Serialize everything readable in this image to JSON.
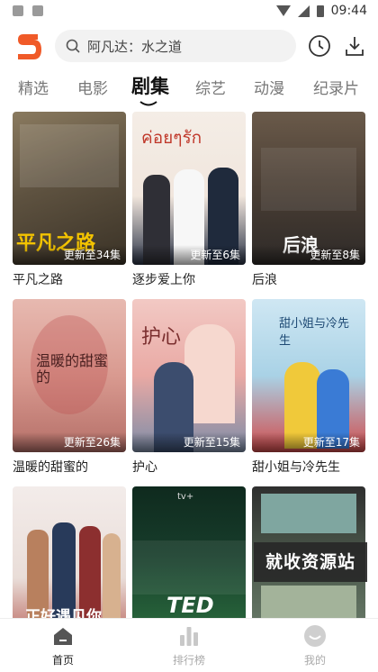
{
  "status_bar": {
    "time": "09:44"
  },
  "header": {
    "search_placeholder": "阿凡达：水之道"
  },
  "tabs": [
    {
      "label": "精选"
    },
    {
      "label": "电影"
    },
    {
      "label": "剧集",
      "active": true
    },
    {
      "label": "综艺"
    },
    {
      "label": "动漫"
    },
    {
      "label": "纪录片"
    }
  ],
  "cards": [
    {
      "title": "平凡之路",
      "update": "更新至34集",
      "poster_text": "平凡之路"
    },
    {
      "title": "逐步爱上你",
      "update": "更新至6集",
      "poster_text": "ค่อยๆรัก"
    },
    {
      "title": "后浪",
      "update": "更新至8集",
      "poster_text": "后浪"
    },
    {
      "title": "温暖的甜蜜的",
      "update": "更新至26集",
      "poster_text": "温暖的甜蜜的"
    },
    {
      "title": "护心",
      "update": "更新至15集",
      "poster_text": "护心"
    },
    {
      "title": "甜小姐与冷先生",
      "update": "更新至17集",
      "poster_text": "甜小姐与冷先生"
    },
    {
      "title": "",
      "update": "",
      "poster_text": "正好遇见你"
    },
    {
      "title": "",
      "update": "",
      "poster_text": "TED"
    },
    {
      "title": "",
      "update": "",
      "poster_text": ""
    }
  ],
  "watermark": "就收资源站",
  "bottom_nav": [
    {
      "label": "首页",
      "active": true,
      "icon": "home-icon"
    },
    {
      "label": "排行榜",
      "active": false,
      "icon": "ranking-icon"
    },
    {
      "label": "我的",
      "active": false,
      "icon": "profile-icon"
    }
  ],
  "colors": {
    "brand": "#f05a28",
    "active_text": "#111111",
    "inactive_text": "#777777"
  }
}
